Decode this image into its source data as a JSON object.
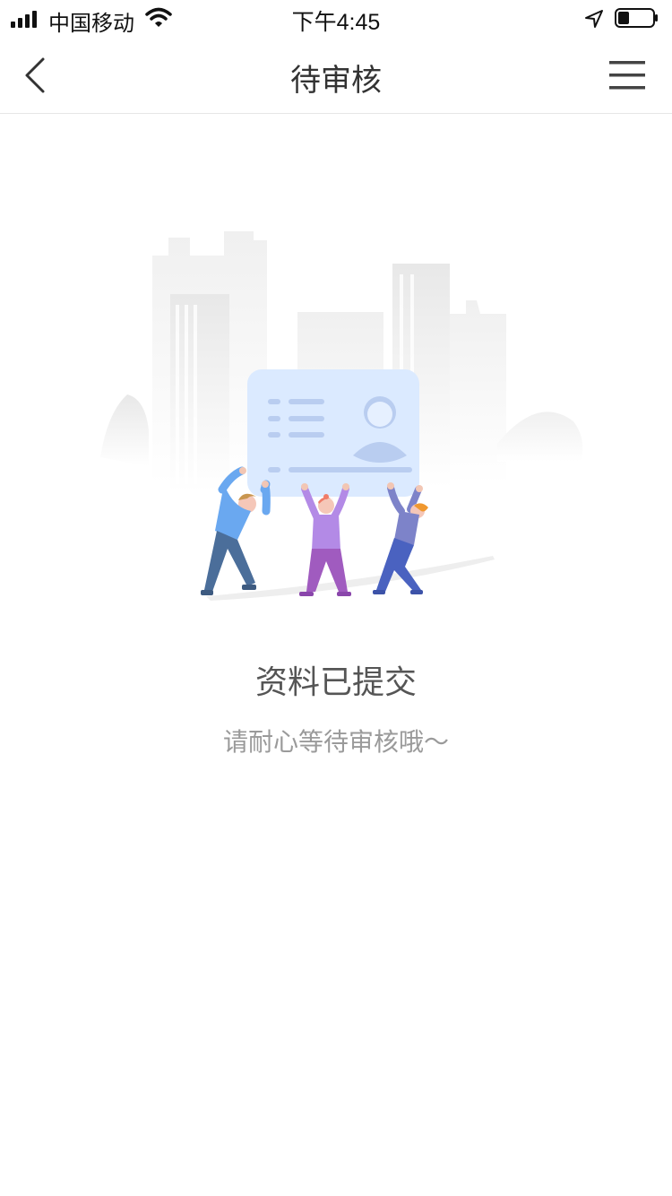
{
  "status_bar": {
    "carrier": "中国移动",
    "time": "下午4:45",
    "icons": [
      "signal-icon",
      "wifi-icon",
      "location-arrow-icon",
      "battery-icon"
    ]
  },
  "nav": {
    "title": "待审核",
    "back_icon": "chevron-left-icon",
    "menu_icon": "hamburger-menu-icon"
  },
  "content": {
    "illustration": "people-holding-id-card",
    "title": "资料已提交",
    "subtitle": "请耐心等待审核哦～"
  },
  "colors": {
    "title_text": "#555555",
    "subtitle_text": "#9a9a9a",
    "card_fill": "#dbeaff",
    "card_lines": "#b9cdf0"
  }
}
